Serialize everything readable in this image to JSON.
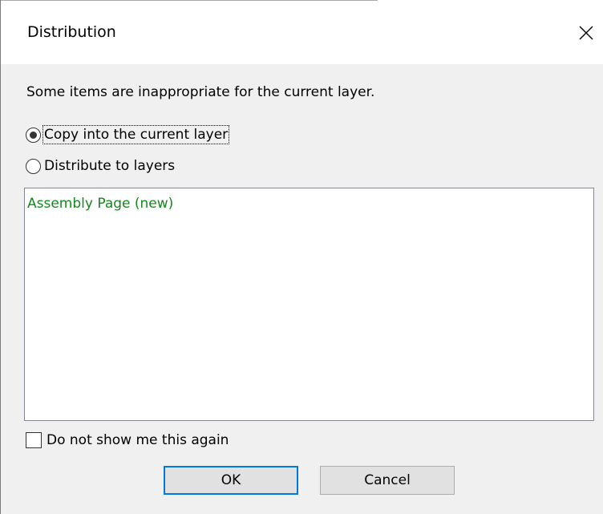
{
  "dialog": {
    "title": "Distribution",
    "close_icon": "close-icon",
    "message": "Some items are inappropriate for the current layer.",
    "options": [
      {
        "label": "Copy into the current layer",
        "selected": true
      },
      {
        "label": "Distribute to layers",
        "selected": false
      }
    ],
    "list_items": [
      "Assembly Page (new)"
    ],
    "checkbox": {
      "label": "Do not show me this again",
      "checked": false
    },
    "ok_label": "OK",
    "cancel_label": "Cancel"
  },
  "colors": {
    "list_item_text": "#14881f",
    "default_button_border": "#0078d7",
    "dialog_background": "#f0f0f0"
  }
}
